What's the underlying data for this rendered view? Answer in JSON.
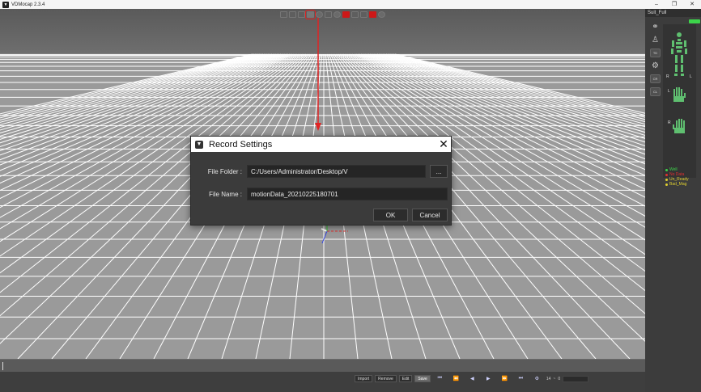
{
  "window": {
    "title": "VDMocap 2.3.4"
  },
  "dialog": {
    "title": "Record Settings",
    "file_folder_label": "File Folder :",
    "file_folder_value": "C:/Users/Administrator/Desktop/V",
    "browse_label": "...",
    "file_name_label": "File Name :",
    "file_name_value": "motionData_20210225180701",
    "ok_label": "OK",
    "cancel_label": "Cancel"
  },
  "panel": {
    "suit_name": "Suit_Full",
    "tool1": "TD",
    "tool2": "CR",
    "tool3": "CL",
    "legend": [
      "Well",
      "No Data",
      "Un_Ready",
      "Bad_Mag"
    ]
  },
  "bottom": {
    "import": "Import",
    "remove": "Remove",
    "edit": "Edit",
    "save": "Save",
    "frame_value": "14",
    "separator": "~",
    "frame_counter": "0"
  },
  "colors": {
    "accent_red": "#e02424",
    "status_well": "#3cd44a",
    "status_no_data": "#e03030",
    "status_warning": "#e0d030"
  }
}
